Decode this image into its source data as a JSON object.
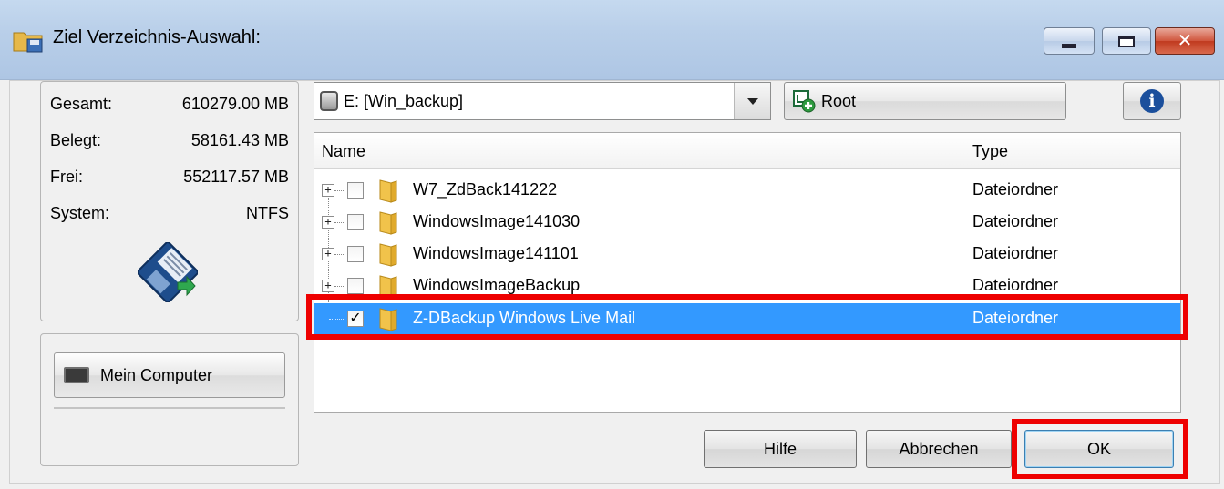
{
  "window": {
    "title": "Ziel Verzeichnis-Auswahl:",
    "title_icon": "folder-save-icon",
    "controls": [
      "minimize-icon",
      "maximize-icon",
      "close-icon"
    ],
    "close_color": "#c03a1f"
  },
  "drive_info": {
    "rows": [
      {
        "label": "Gesamt:",
        "value": "610279.00 MB"
      },
      {
        "label": "Belegt:",
        "value": "58161.43 MB"
      },
      {
        "label": "Frei:",
        "value": "552117.57 MB"
      },
      {
        "label": "System:",
        "value": "NTFS"
      }
    ],
    "icon": "floppy-disk-icon"
  },
  "nav": {
    "my_computer_label": "Mein Computer",
    "my_computer_icon": "computer-icon"
  },
  "toolbar": {
    "drive_select_value": "E:  [Win_backup]",
    "drive_icon": "drive-icon",
    "root_label": "Root",
    "root_icon": "root-add-icon",
    "info_icon": "info-icon"
  },
  "tree": {
    "columns": {
      "name": "Name",
      "type": "Type"
    },
    "rows": [
      {
        "name": "W7_ZdBack141222",
        "type": "Dateiordner",
        "checked": false,
        "expander": "+"
      },
      {
        "name": "WindowsImage141030",
        "type": "Dateiordner",
        "checked": false,
        "expander": "+"
      },
      {
        "name": "WindowsImage141101",
        "type": "Dateiordner",
        "checked": false,
        "expander": "+"
      },
      {
        "name": "WindowsImageBackup",
        "type": "Dateiordner",
        "checked": false,
        "expander": "+"
      },
      {
        "name": "Z-DBackup Windows Live Mail",
        "type": "Dateiordner",
        "checked": true,
        "selected": true,
        "checkmark": "✓"
      }
    ],
    "selection_color": "#3399ff"
  },
  "buttons": {
    "help": "Hilfe",
    "cancel": "Abbrechen",
    "ok": "OK"
  },
  "highlight_color": "#ee0000"
}
